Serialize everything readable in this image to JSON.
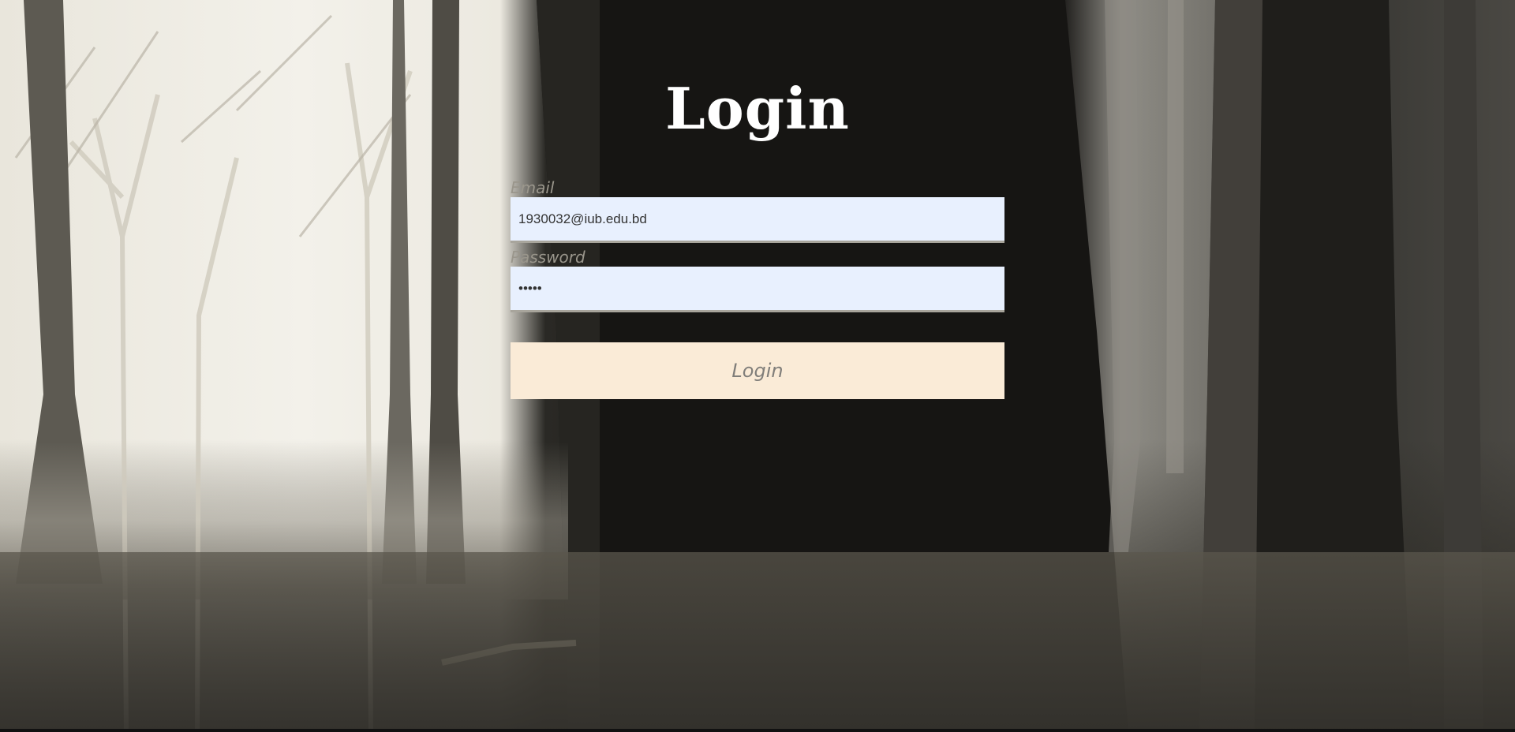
{
  "page": {
    "title": "Login"
  },
  "form": {
    "email": {
      "label": "Email",
      "value": "1930032@iub.edu.bd"
    },
    "password": {
      "label": "Password",
      "value": "•••••"
    },
    "submit_label": "Login"
  },
  "colors": {
    "button_bg": "#faebd7",
    "input_bg": "#e8f0fe",
    "title_color": "#ffffff"
  }
}
